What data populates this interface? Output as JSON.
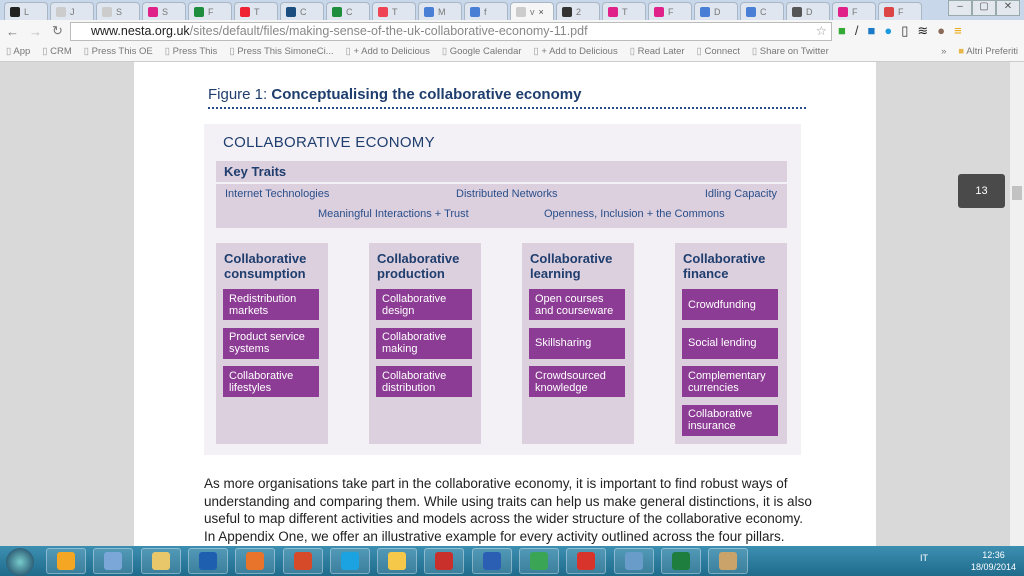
{
  "browser": {
    "tabs": [
      {
        "label": "L",
        "color": "#222"
      },
      {
        "label": "J",
        "color": "#ccc"
      },
      {
        "label": "S",
        "color": "#ccc"
      },
      {
        "label": "S",
        "color": "#e0218a"
      },
      {
        "label": "F",
        "color": "#1e8e3e"
      },
      {
        "label": "T",
        "color": "#e23"
      },
      {
        "label": "C",
        "color": "#1c4e80"
      },
      {
        "label": "C",
        "color": "#1e8e3e"
      },
      {
        "label": "T",
        "color": "#e45"
      },
      {
        "label": "M",
        "color": "#4a7fd6"
      },
      {
        "label": "f",
        "color": "#4a7fd6"
      },
      {
        "label": "v",
        "color": "#ccc",
        "active": true
      },
      {
        "label": "2",
        "color": "#333"
      },
      {
        "label": "T",
        "color": "#e0218a"
      },
      {
        "label": "F",
        "color": "#e0218a"
      },
      {
        "label": "D",
        "color": "#4a7fd6"
      },
      {
        "label": "C",
        "color": "#4a7fd6"
      },
      {
        "label": "D",
        "color": "#555"
      },
      {
        "label": "F",
        "color": "#e0218a"
      },
      {
        "label": "F",
        "color": "#d44"
      }
    ],
    "url_host": "www.nesta.org.uk",
    "url_path": "/sites/default/files/making-sense-of-the-uk-collaborative-economy-11.pdf",
    "bookmarks": [
      "App",
      "CRM",
      "Press This OE",
      "Press This",
      "Press This SimoneCi...",
      "+ Add to Delicious",
      "Google Calendar",
      "+ Add to Delicious",
      "Read Later",
      "Connect",
      "Share on Twitter"
    ],
    "bookmarks_overflow": "»",
    "other_bookmarks": "Altri Preferiti"
  },
  "viewer": {
    "page_number": "13"
  },
  "figure": {
    "label": "Figure 1:",
    "title": "Conceptualising the collaborative economy",
    "heading": "COLLABORATIVE ECONOMY",
    "key_traits_title": "Key Traits",
    "traits": [
      "Internet Technologies",
      "Distributed Networks",
      "Idling Capacity",
      "Meaningful Interactions + Trust",
      "Openness, Inclusion + the Commons"
    ],
    "pillars": [
      {
        "title_1": "Collaborative",
        "title_2": "consumption",
        "items": [
          "Redistribution markets",
          "Product service systems",
          "Collaborative lifestyles"
        ]
      },
      {
        "title_1": "Collaborative",
        "title_2": "production",
        "items": [
          "Collaborative design",
          "Collaborative making",
          "Collaborative distribution"
        ]
      },
      {
        "title_1": "Collaborative",
        "title_2": "learning",
        "items": [
          "Open courses and courseware",
          "Skillsharing",
          "Crowdsourced knowledge"
        ]
      },
      {
        "title_1": "Collaborative",
        "title_2": "finance",
        "items": [
          "Crowdfunding",
          "Social lending",
          "Complementary currencies",
          "Collaborative insurance"
        ]
      }
    ],
    "item_color": "#8c3c94",
    "title_color": "#1f3e6e"
  },
  "body_text": "As more organisations take part in the collaborative economy, it is important to find robust ways of understanding and comparing them. While using traits can help us make general distinctions, it is also useful to map different activities and models across the wider structure of the collaborative economy. In Appendix One, we offer an illustrative example for every activity outlined across the four pillars.",
  "taskbar": {
    "language": "IT",
    "time": "12:36",
    "date": "18/09/2014"
  }
}
